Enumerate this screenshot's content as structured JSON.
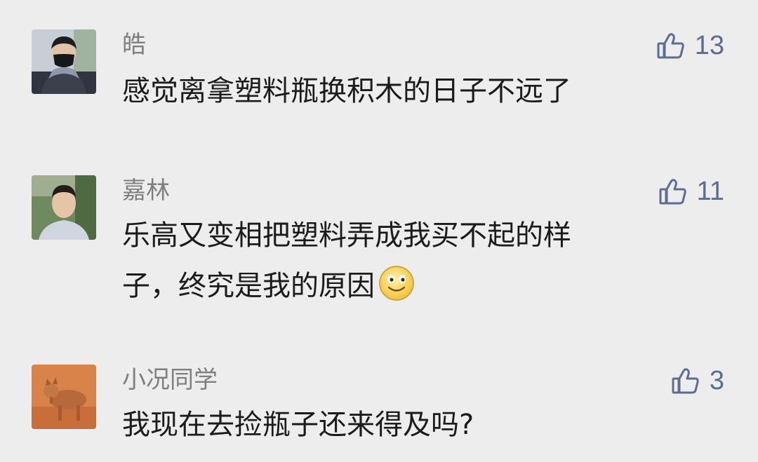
{
  "comments": [
    {
      "name": "皓",
      "likes": "13",
      "text": "感觉离拿塑料瓶换积木的日子不远了",
      "avatar_icon": "man-in-mask-photo"
    },
    {
      "name": "嘉林",
      "likes": "11",
      "text_line1": "乐高又变相把塑料弄成我买不起的样",
      "text_line2": "子，终究是我的原因",
      "emoji": "smiley-face",
      "avatar_icon": "man-portrait-photo"
    },
    {
      "name": "小况同学",
      "likes": "3",
      "text": "我现在去捡瓶子还来得及吗?",
      "avatar_icon": "dog-photo"
    }
  ],
  "colors": {
    "background": "#ededed",
    "name": "#7f7f7f",
    "text": "#1b1b1b",
    "like": "#5d6d8f"
  }
}
